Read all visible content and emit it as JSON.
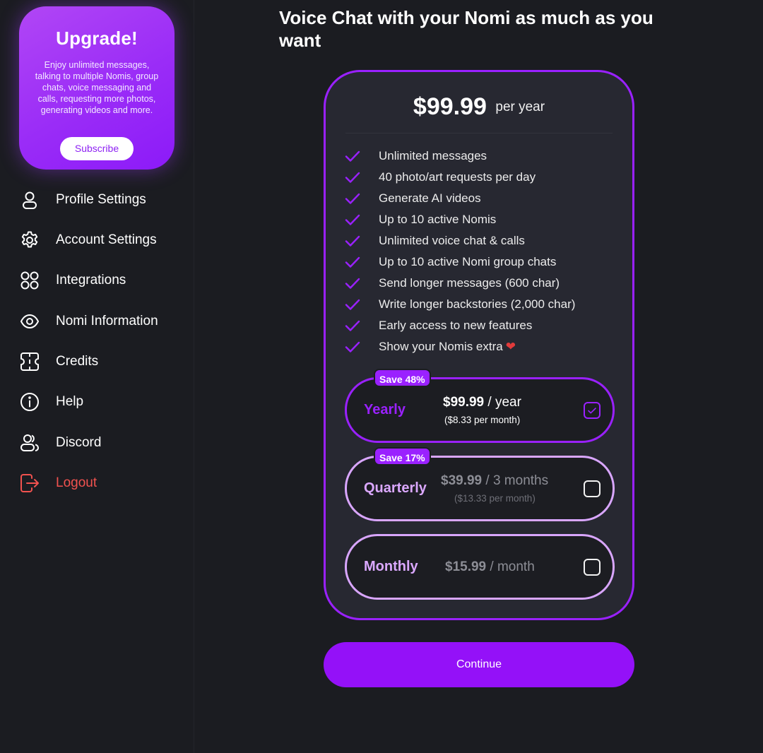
{
  "upgrade": {
    "title": "Upgrade!",
    "description": "Enjoy unlimited messages, talking to multiple Nomis, group chats, voice messaging and calls, requesting more photos, generating videos and more.",
    "subscribe_label": "Subscribe"
  },
  "sidebar": {
    "items": [
      {
        "label": "Profile Settings",
        "icon": "person-icon"
      },
      {
        "label": "Account Settings",
        "icon": "gear-icon"
      },
      {
        "label": "Integrations",
        "icon": "grid-circles-icon"
      },
      {
        "label": "Nomi Information",
        "icon": "eye-icon"
      },
      {
        "label": "Credits",
        "icon": "ticket-icon"
      },
      {
        "label": "Help",
        "icon": "info-icon"
      },
      {
        "label": "Discord",
        "icon": "users-icon"
      },
      {
        "label": "Logout",
        "icon": "logout-icon"
      }
    ]
  },
  "main": {
    "heading": "Voice Chat with your Nomi as much as you want",
    "plan": {
      "price": "$99.99",
      "period": "per year",
      "features": [
        "Unlimited messages",
        "40 photo/art requests per day",
        "Generate AI videos",
        "Up to 10 active Nomis",
        "Unlimited voice chat & calls",
        "Up to 10 active Nomi group chats",
        "Send longer messages (600 char)",
        "Write longer backstories (2,000 char)",
        "Early access to new features",
        "Show your Nomis extra"
      ],
      "heart": "❤"
    },
    "options": [
      {
        "name": "Yearly",
        "badge": "Save 48%",
        "amount": "$99.99",
        "unit": " / year",
        "sub": "($8.33 per month)",
        "selected": true
      },
      {
        "name": "Quarterly",
        "badge": "Save 17%",
        "amount": "$39.99",
        "unit": " / 3 months",
        "sub": "($13.33 per month)",
        "selected": false
      },
      {
        "name": "Monthly",
        "badge": "",
        "amount": "$15.99",
        "unit": " / month",
        "sub": "",
        "selected": false
      }
    ],
    "continue_label": "Continue"
  },
  "colors": {
    "accent": "#9a21ff",
    "background": "#1b1c21",
    "card": "#272831",
    "logout": "#f1524f"
  }
}
